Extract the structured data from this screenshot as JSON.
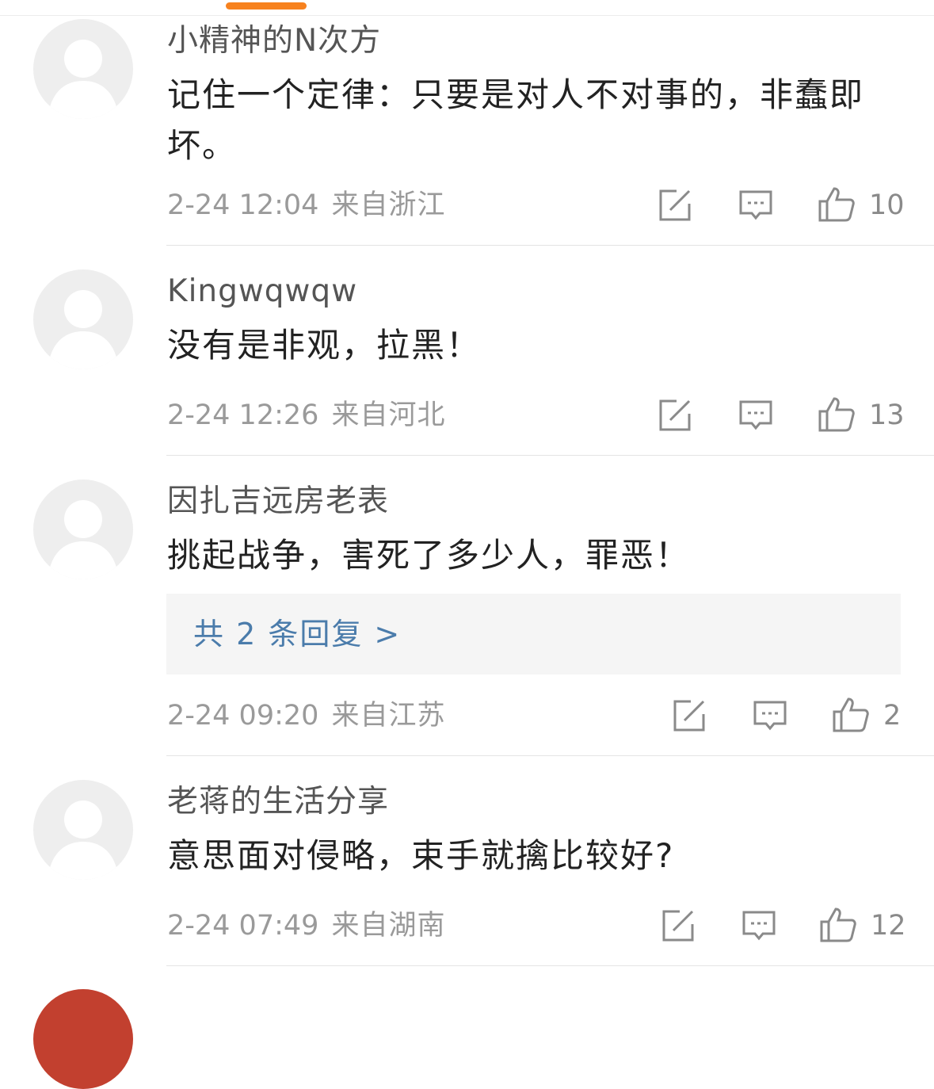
{
  "comments": [
    {
      "username": "小精神的N次方",
      "text": "记住一个定律：只要是对人不对事的，非蠢即坏。",
      "date": "2-24 12:04",
      "location": "来自浙江",
      "likes": "10"
    },
    {
      "username": "Kingwqwqw",
      "text": "没有是非观，拉黑！",
      "date": "2-24 12:26",
      "location": "来自河北",
      "likes": "13"
    },
    {
      "username": "因扎吉远房老表",
      "text": "挑起战争，害死了多少人，罪恶！",
      "replies": "共 2 条回复 >",
      "date": "2-24 09:20",
      "location": "来自江苏",
      "likes": "2"
    },
    {
      "username": "老蒋的生活分享",
      "text": "意思面对侵略，束手就擒比较好?",
      "date": "2-24 07:49",
      "location": "来自湖南",
      "likes": "12"
    }
  ],
  "colors": {
    "accent": "#f7821f",
    "link": "#4b7cab",
    "meta": "#9a9a9a"
  },
  "icons": [
    "avatar-placeholder",
    "edit-repost-icon",
    "comment-icon",
    "thumbs-up-icon"
  ]
}
